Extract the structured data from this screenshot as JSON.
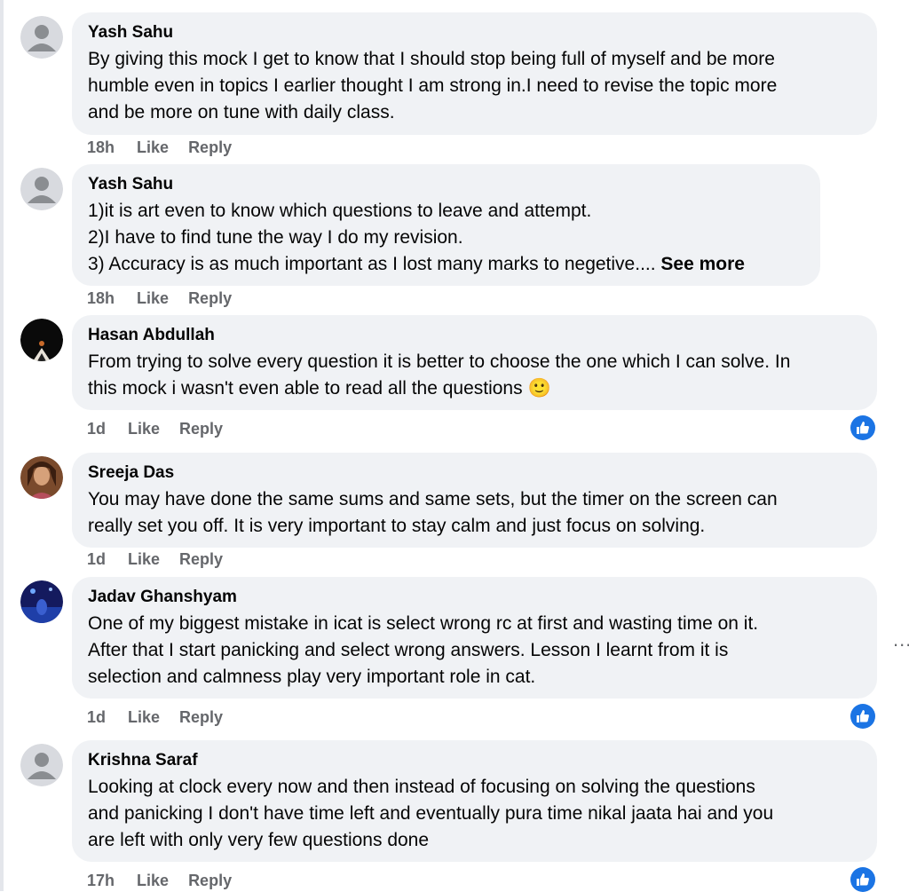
{
  "comments": [
    {
      "author": "Yash Sahu",
      "avatar": "default-avatar-icon",
      "lines": [
        "By giving this mock I get to know that I should stop being full of myself and be more",
        "humble even in topics I earlier thought I am strong in.I need to revise the topic more",
        "and be more on tune with daily class."
      ],
      "time": "18h",
      "like": "Like",
      "reply": "Reply"
    },
    {
      "author": "Yash Sahu",
      "avatar": "default-avatar-icon",
      "lines": [
        "1)it is art even to know which questions to leave and attempt.",
        "2)I have to find tune the way I do my revision.",
        "3) Accuracy is as much important as I lost many marks to negetive.... "
      ],
      "see_more": "See more",
      "time": "18h",
      "like": "Like",
      "reply": "Reply"
    },
    {
      "author": "Hasan Abdullah",
      "avatar": "profile-photo",
      "lines": [
        "From trying to solve every question it is better to choose the one which I can solve. In",
        "this mock i wasn't even able to read all the questions"
      ],
      "emoji": "🙂",
      "time": "1d",
      "like": "Like",
      "reply": "Reply",
      "reaction": "like-reaction-icon"
    },
    {
      "author": "Sreeja Das",
      "avatar": "profile-photo",
      "lines": [
        "You may have done the same sums and same sets, but the timer on the screen can",
        "really set you off. It is very important to stay calm and just focus on solving."
      ],
      "time": "1d",
      "like": "Like",
      "reply": "Reply"
    },
    {
      "author": "Jadav Ghanshyam",
      "avatar": "profile-photo",
      "lines": [
        "One of my biggest mistake in icat is select wrong rc at first and wasting time on it.",
        "After that I start panicking and select wrong answers. Lesson I learnt from it is",
        "selection and calmness play very important role in cat."
      ],
      "time": "1d",
      "like": "Like",
      "reply": "Reply",
      "reaction": "like-reaction-icon"
    },
    {
      "author": "Krishna Saraf",
      "avatar": "default-avatar-icon",
      "lines": [
        "Looking at clock every now and then instead of focusing on solving the questions",
        "and panicking I don't have time left and eventually pura time nikal jaata hai and you",
        "are left with only very few questions done"
      ],
      "time": "17h",
      "like": "Like",
      "reply": "Reply",
      "reaction": "like-reaction-icon"
    }
  ],
  "more_menu": "...",
  "colors": {
    "bubble": "#f0f2f5",
    "meta": "#65676b",
    "like_blue": "#1b74e4"
  }
}
